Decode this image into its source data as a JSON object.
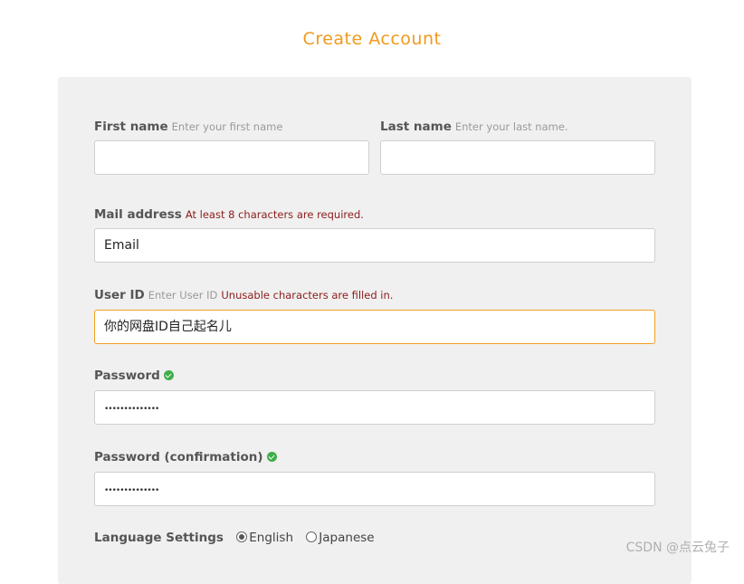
{
  "page": {
    "title": "Create Account"
  },
  "form": {
    "first_name": {
      "label": "First name",
      "hint": "Enter your first name",
      "value": ""
    },
    "last_name": {
      "label": "Last name",
      "hint": "Enter your last name.",
      "value": ""
    },
    "mail": {
      "label": "Mail address",
      "error": "At least 8 characters are required.",
      "value": "Email"
    },
    "user_id": {
      "label": "User ID",
      "hint": "Enter User ID",
      "error": "Unusable characters are filled in.",
      "value": "你的网盘ID自己起名儿"
    },
    "password": {
      "label": "Password",
      "value": "••••••••••••••"
    },
    "password_confirm": {
      "label": "Password (confirmation)",
      "value": "••••••••••••••"
    },
    "language": {
      "label": "Language Settings",
      "options": [
        {
          "label": "English",
          "selected": true
        },
        {
          "label": "Japanese",
          "selected": false
        }
      ]
    }
  },
  "watermark": "CSDN @点云兔子",
  "colors": {
    "accent": "#f09a1c",
    "error": "#8b1c1c",
    "success": "#3fae49",
    "panel": "#f0f0f0"
  }
}
